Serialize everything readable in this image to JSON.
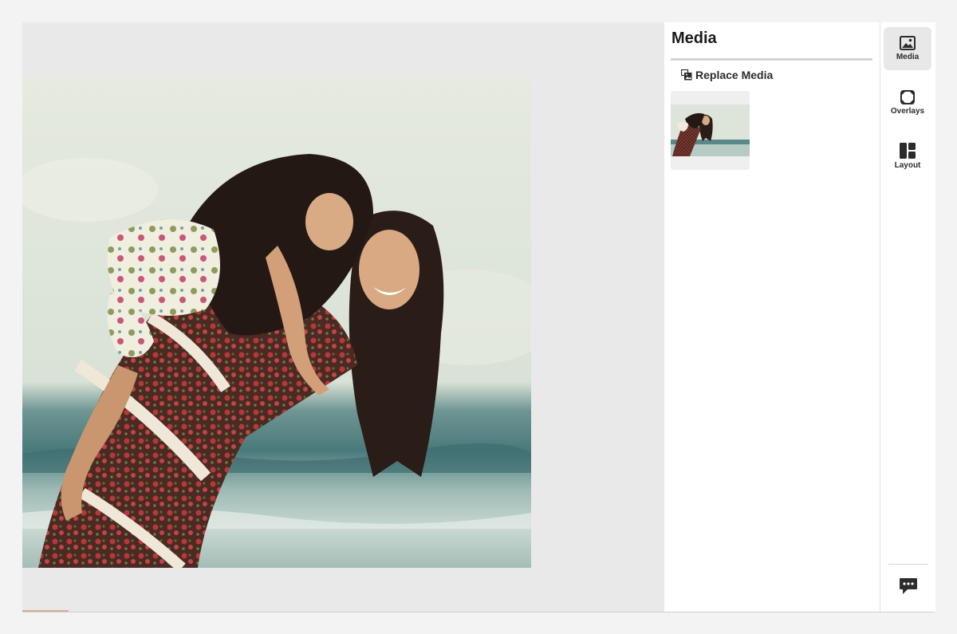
{
  "panel": {
    "title": "Media",
    "replace_label": "Replace Media"
  },
  "rail": {
    "items": [
      {
        "label": "Media",
        "icon": "image-icon",
        "active": true
      },
      {
        "label": "Overlays",
        "icon": "overlays-icon",
        "active": false
      },
      {
        "label": "Layout",
        "icon": "layout-icon",
        "active": false
      }
    ],
    "feedback_icon": "chat-feedback-icon"
  },
  "canvas": {
    "image": "photo-mother-daughter-beach",
    "accent_color": "#d8b090"
  }
}
